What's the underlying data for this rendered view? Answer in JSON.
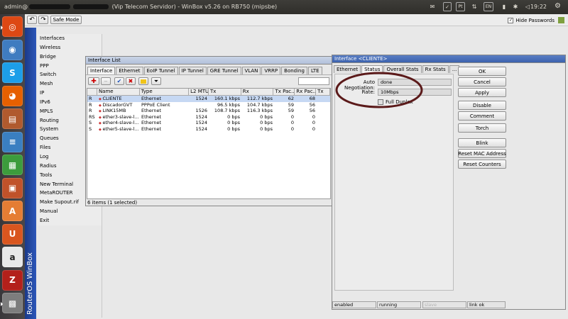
{
  "topbar": {
    "title_prefix": "admin@",
    "title_suffix": "(Vip Telecom Servidor) - WinBox v5.26 on RB750 (mipsbe)",
    "clock": "19:22",
    "tray": [
      "Pt",
      "EN"
    ]
  },
  "launcher": {
    "apps": [
      {
        "name": "ubuntu-dash",
        "color": "#dd4814",
        "glyph": "◎"
      },
      {
        "name": "chromium",
        "color": "#3f7cc0",
        "glyph": "◉"
      },
      {
        "name": "skype",
        "color": "#1d9ee8",
        "glyph": "S"
      },
      {
        "name": "firefox",
        "color": "#e66000",
        "glyph": "◕"
      },
      {
        "name": "files",
        "color": "#b05a2e",
        "glyph": "▤"
      },
      {
        "name": "writer",
        "color": "#3a7fc1",
        "glyph": "≡"
      },
      {
        "name": "calc",
        "color": "#3c9c3c",
        "glyph": "▦"
      },
      {
        "name": "impress",
        "color": "#c0522a",
        "glyph": "▣"
      },
      {
        "name": "software-center",
        "color": "#e57d34",
        "glyph": "A"
      },
      {
        "name": "ubuntu-one",
        "color": "#d9561f",
        "glyph": "U"
      },
      {
        "name": "amazon",
        "color": "#e8e8e8",
        "glyph": "a"
      },
      {
        "name": "filezilla",
        "color": "#b3201b",
        "glyph": "Z"
      },
      {
        "name": "winbox",
        "color": "#7d7d7d",
        "glyph": "▩"
      }
    ]
  },
  "toolbar": {
    "safe_mode": "Safe Mode",
    "hide_passwords": "Hide Passwords"
  },
  "brand": "RouterOS WinBox",
  "menu": [
    {
      "label": "Interfaces",
      "sub": false
    },
    {
      "label": "Wireless",
      "sub": false
    },
    {
      "label": "Bridge",
      "sub": false
    },
    {
      "label": "PPP",
      "sub": false
    },
    {
      "label": "Switch",
      "sub": false
    },
    {
      "label": "Mesh",
      "sub": false
    },
    {
      "label": "IP",
      "sub": true
    },
    {
      "label": "IPv6",
      "sub": true
    },
    {
      "label": "MPLS",
      "sub": true
    },
    {
      "label": "Routing",
      "sub": true
    },
    {
      "label": "System",
      "sub": true
    },
    {
      "label": "Queues",
      "sub": false
    },
    {
      "label": "Files",
      "sub": false
    },
    {
      "label": "Log",
      "sub": false
    },
    {
      "label": "Radius",
      "sub": false
    },
    {
      "label": "Tools",
      "sub": true
    },
    {
      "label": "New Terminal",
      "sub": false
    },
    {
      "label": "MetaROUTER",
      "sub": false
    },
    {
      "label": "Make Supout.rif",
      "sub": false
    },
    {
      "label": "Manual",
      "sub": false
    },
    {
      "label": "Exit",
      "sub": false
    }
  ],
  "iface_list": {
    "title": "Interface List",
    "tabs": [
      "Interface",
      "Ethernet",
      "EoIP Tunnel",
      "IP Tunnel",
      "GRE Tunnel",
      "VLAN",
      "VRRP",
      "Bonding",
      "LTE"
    ],
    "columns": [
      "",
      "Name",
      "Type",
      "L2 MTU",
      "Tx",
      "Rx",
      "Tx Pac...",
      "Rx Pac...",
      "Tx"
    ],
    "rows": [
      [
        "R",
        "CLIENTE",
        "Ethernet",
        "1524",
        "160.1 kbps",
        "112.7 kbps",
        "62",
        "68"
      ],
      [
        "R",
        "DiscadorGVT",
        "PPPoE Client",
        "",
        "96.5 kbps",
        "104.7 kbps",
        "59",
        "56"
      ],
      [
        "R",
        "LINK15MB",
        "Ethernet",
        "1526",
        "108.7 kbps",
        "116.3 kbps",
        "59",
        "56"
      ],
      [
        "RS",
        "ether3-slave-l...",
        "Ethernet",
        "1524",
        "0 bps",
        "0 bps",
        "0",
        "0"
      ],
      [
        "S",
        "ether4-slave-l...",
        "Ethernet",
        "1524",
        "0 bps",
        "0 bps",
        "0",
        "0"
      ],
      [
        "S",
        "ether5-slave-l...",
        "Ethernet",
        "1524",
        "0 bps",
        "0 bps",
        "0",
        "0"
      ]
    ],
    "selected_row": 0,
    "footer": "6 items (1 selected)"
  },
  "iface_detail": {
    "title": "Interface <CLIENTE>",
    "tabs": [
      "Ethernet",
      "Status",
      "Overall Stats",
      "Rx Stats",
      "..."
    ],
    "active_tab": 1,
    "auto_neg_label": "Auto Negotiation:",
    "auto_neg_value": "done",
    "rate_label": "Rate:",
    "rate_value": "10Mbps",
    "full_duplex_label": "Full Duplex",
    "buttons": [
      "OK",
      "Cancel",
      "Apply",
      "Disable",
      "Comment",
      "Torch",
      "Blink",
      "Reset MAC Address",
      "Reset Counters"
    ],
    "status": [
      "enabled",
      "running",
      "slave",
      "link ok"
    ]
  },
  "colors": {
    "menu_bg": "#ececec",
    "brand_blue": "#2347a3",
    "selected_row": "#c6d8f3",
    "annotation": "#5b1a1a"
  }
}
